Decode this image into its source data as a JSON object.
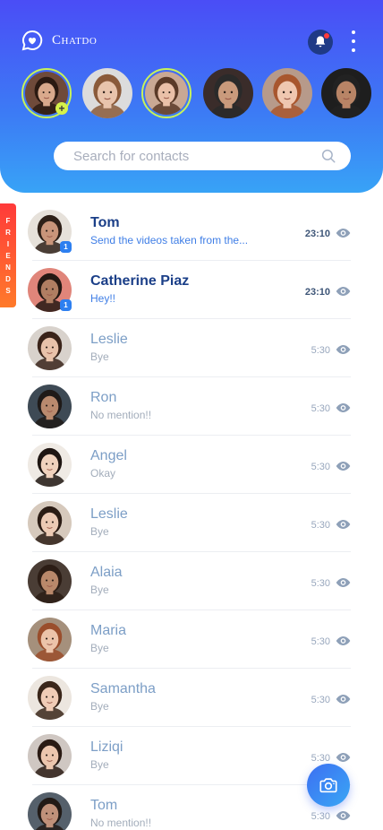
{
  "app": {
    "name": "Chatdo"
  },
  "header": {
    "brand_icon": "chat-heart-icon",
    "bell_icon": "bell-icon",
    "menu_icon": "more-vertical-icon"
  },
  "stories": [
    {
      "name": "story-1",
      "skin": "#d9a98c",
      "hair": "#2b1a12",
      "bg": "#6f4a3a",
      "ring": true,
      "add": true
    },
    {
      "name": "story-2",
      "skin": "#e8c4ac",
      "hair": "#8a5a3a",
      "bg": "#dcdcdc",
      "ring": false,
      "add": false
    },
    {
      "name": "story-3",
      "skin": "#eac0a8",
      "hair": "#5a3a28",
      "bg": "#c9a894",
      "ring": true,
      "add": false
    },
    {
      "name": "story-4",
      "skin": "#c99a7c",
      "hair": "#2a2a2a",
      "bg": "#3a2c2a",
      "ring": false,
      "add": false
    },
    {
      "name": "story-5",
      "skin": "#efc7b0",
      "hair": "#a8562e",
      "bg": "#b79a8a",
      "ring": false,
      "add": false
    },
    {
      "name": "story-6",
      "skin": "#b88466",
      "hair": "#222222",
      "bg": "#1e1e1e",
      "ring": false,
      "add": false
    }
  ],
  "search": {
    "placeholder": "Search for contacts",
    "icon": "search-icon"
  },
  "friends_tab": {
    "letters": [
      "F",
      "R",
      "I",
      "E",
      "N",
      "D",
      "S"
    ]
  },
  "chats": [
    {
      "name": "Tom",
      "message": "Send the videos taken from the...",
      "time": "23:10",
      "unread": "1",
      "active": true,
      "skin": "#c9957a",
      "hair": "#2e2018",
      "bg": "#e6e1da"
    },
    {
      "name": "Catherine Piaz",
      "message": "Hey!!",
      "time": "23:10",
      "unread": "1",
      "active": true,
      "skin": "#b07e62",
      "hair": "#241813",
      "bg": "#e0857a"
    },
    {
      "name": "Leslie",
      "message": "Bye",
      "time": "5:30",
      "unread": "",
      "active": false,
      "skin": "#e8c2aa",
      "hair": "#3a241a",
      "bg": "#d8d2cc"
    },
    {
      "name": "Ron",
      "message": "No mention!!",
      "time": "5:30",
      "unread": "",
      "active": false,
      "skin": "#b98a6e",
      "hair": "#1f1a18",
      "bg": "#3e4a55"
    },
    {
      "name": "Angel",
      "message": "Okay",
      "time": "5:30",
      "unread": "",
      "active": false,
      "skin": "#f0d2bd",
      "hair": "#1f1612",
      "bg": "#efeae4"
    },
    {
      "name": "Leslie",
      "message": "Bye",
      "time": "5:30",
      "unread": "",
      "active": false,
      "skin": "#eccab4",
      "hair": "#2b1c14",
      "bg": "#d6c9bc"
    },
    {
      "name": "Alaia",
      "message": "Bye",
      "time": "5:30",
      "unread": "",
      "active": false,
      "skin": "#b9886a",
      "hair": "#2c1d15",
      "bg": "#4a3d35"
    },
    {
      "name": "Maria",
      "message": "Bye",
      "time": "5:30",
      "unread": "",
      "active": false,
      "skin": "#ecc4aa",
      "hair": "#9a4e2c",
      "bg": "#a5907c"
    },
    {
      "name": "Samantha",
      "message": "Bye",
      "time": "5:30",
      "unread": "",
      "active": false,
      "skin": "#f0ccb6",
      "hair": "#3a261a",
      "bg": "#ece6df"
    },
    {
      "name": "Liziqi",
      "message": "Bye",
      "time": "5:30",
      "unread": "",
      "active": false,
      "skin": "#ecc6ae",
      "hair": "#2a1b14",
      "bg": "#cfc7c2"
    },
    {
      "name": "Tom",
      "message": "No mention!!",
      "time": "5:30",
      "unread": "",
      "active": false,
      "skin": "#c0917a",
      "hair": "#221a16",
      "bg": "#55606b"
    }
  ],
  "fab": {
    "icon": "camera-icon"
  },
  "colors": {
    "accent": "#3c7cf5",
    "active_name": "#1b3f88",
    "unread_badge": "#2d7ff0",
    "friends_tab": "#ff5a30"
  }
}
